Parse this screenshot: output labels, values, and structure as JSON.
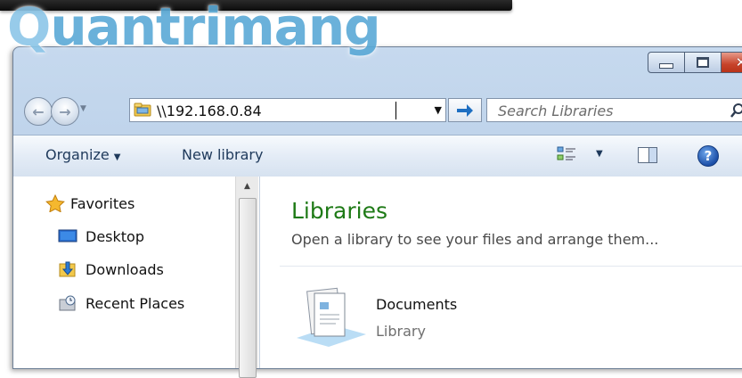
{
  "watermark": "uantrimang",
  "window": {
    "controls": {
      "minimize": "minimize-icon",
      "maximize": "maximize-icon",
      "close": "close-icon"
    }
  },
  "address": {
    "value": "\\\\192.168.0.84",
    "icon": "network-folder-icon"
  },
  "search": {
    "placeholder": "Search Libraries",
    "icon": "search-icon"
  },
  "toolbar": {
    "organize_label": "Organize",
    "new_library_label": "New library",
    "views_icon": "change-view-icon",
    "preview_icon": "preview-pane-icon",
    "help_icon": "help-icon"
  },
  "sidebar": {
    "items": [
      {
        "label": "Favorites",
        "icon": "star-icon"
      },
      {
        "label": "Desktop",
        "icon": "desktop-icon"
      },
      {
        "label": "Downloads",
        "icon": "downloads-icon"
      },
      {
        "label": "Recent Places",
        "icon": "recent-places-icon"
      }
    ]
  },
  "main": {
    "title": "Libraries",
    "subtitle": "Open a library to see your files and arrange them...",
    "items": [
      {
        "name": "Documents",
        "type": "Library",
        "icon": "documents-library-icon"
      }
    ]
  },
  "colors": {
    "title_green": "#1e7a16",
    "frame_blue": "#b9cfe8",
    "close_red": "#c7432b"
  }
}
